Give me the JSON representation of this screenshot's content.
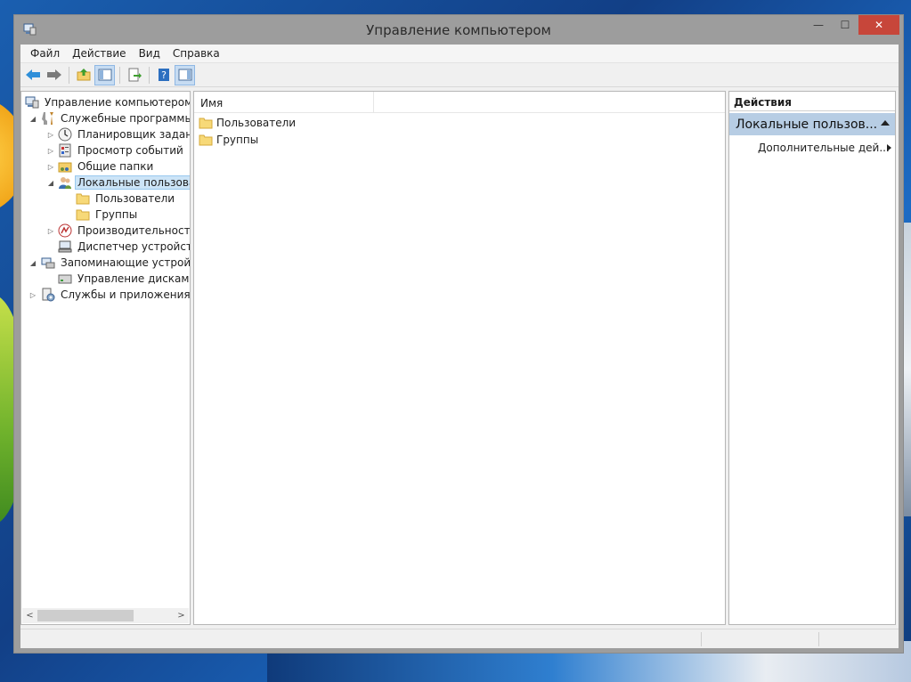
{
  "window": {
    "title": "Управление компьютером",
    "min_glyph": "—",
    "max_glyph": "☐",
    "close_glyph": "✕"
  },
  "menu": [
    "Файл",
    "Действие",
    "Вид",
    "Справка"
  ],
  "toolbar": {
    "icons": [
      "back-arrow-icon",
      "forward-arrow-icon",
      "up-folder-icon",
      "show-hide-console-tree-icon",
      "export-list-icon",
      "help-icon",
      "show-hide-action-pane-icon"
    ]
  },
  "tree": {
    "root": "Управление компьютером (л",
    "system_tools": "Служебные программы",
    "task_scheduler": "Планировщик заданий",
    "event_viewer": "Просмотр событий",
    "shared_folders": "Общие папки",
    "local_users": "Локальные пользовате",
    "users": "Пользователи",
    "groups": "Группы",
    "performance": "Производительность",
    "device_manager": "Диспетчер устройств",
    "storage": "Запоминающие устройст",
    "disk_management": "Управление дисками",
    "services_apps": "Службы и приложения"
  },
  "list": {
    "column_name": "Имя",
    "items": [
      "Пользователи",
      "Группы"
    ]
  },
  "actions": {
    "header": "Действия",
    "group": "Локальные пользов...",
    "more": "Дополнительные дей..."
  },
  "colors": {
    "selection": "#cce4f7",
    "actions_group_bg": "#b7cde4",
    "close_button": "#c7463a",
    "titlebar": "#9d9d9d"
  }
}
